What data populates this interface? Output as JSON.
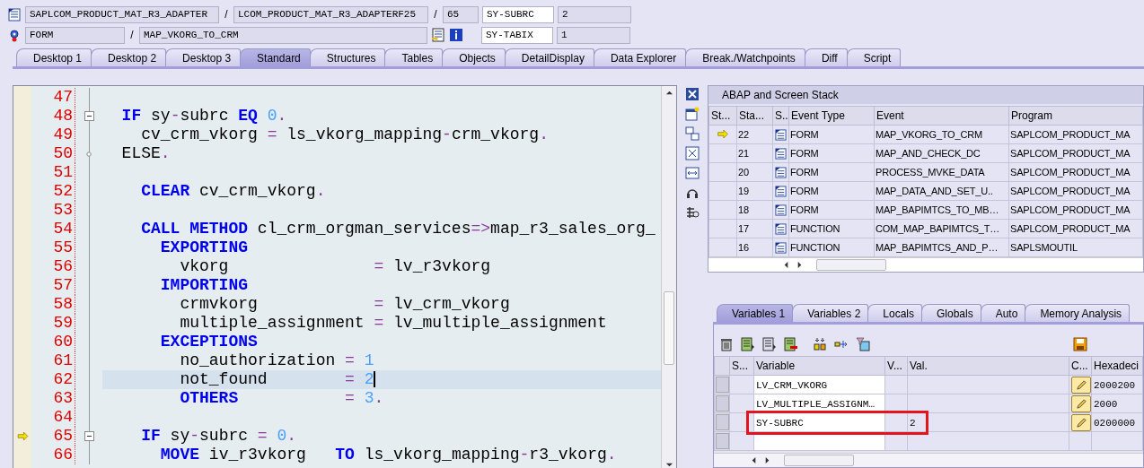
{
  "header": {
    "program": "SAPLCOM_PRODUCT_MAT_R3_ADAPTER",
    "sep_1": "/",
    "include": "LCOM_PRODUCT_MAT_R3_ADAPTERF25",
    "sep_2": "/",
    "line": "65",
    "event_type": "FORM",
    "sep_3": "/",
    "event": "MAP_VKORG_TO_CRM"
  },
  "system_fields": [
    {
      "name": "SY-SUBRC",
      "value": "2"
    },
    {
      "name": "SY-TABIX",
      "value": "1"
    }
  ],
  "tabs": [
    {
      "label": "Desktop 1",
      "selected": false
    },
    {
      "label": "Desktop 2",
      "selected": false
    },
    {
      "label": "Desktop 3",
      "selected": false
    },
    {
      "label": "Standard",
      "selected": true
    },
    {
      "label": "Structures",
      "selected": false
    },
    {
      "label": "Tables",
      "selected": false
    },
    {
      "label": "Objects",
      "selected": false
    },
    {
      "label": "DetailDisplay",
      "selected": false
    },
    {
      "label": "Data Explorer",
      "selected": false
    },
    {
      "label": "Break./Watchpoints",
      "selected": false
    },
    {
      "label": "Diff",
      "selected": false
    },
    {
      "label": "Script",
      "selected": false
    }
  ],
  "code": [
    {
      "number": "47",
      "collapsible": false,
      "branch": false,
      "current": false,
      "cursor": false
    },
    {
      "number": "48",
      "collapsible": true,
      "branch": false,
      "current": false,
      "cursor": false,
      "tokens": [
        {
          "kind": "kw",
          "text": "  IF"
        },
        {
          "kind": "id",
          "text": " sy"
        },
        {
          "kind": "op",
          "text": "-"
        },
        {
          "kind": "id",
          "text": "subrc "
        },
        {
          "kind": "kw",
          "text": "EQ "
        },
        {
          "kind": "num",
          "text": "0"
        },
        {
          "kind": "op",
          "text": "."
        }
      ]
    },
    {
      "number": "49",
      "collapsible": false,
      "branch": false,
      "current": false,
      "cursor": false,
      "tokens": [
        {
          "kind": "id",
          "text": "    cv_crm_vkorg "
        },
        {
          "kind": "op",
          "text": "="
        },
        {
          "kind": "id",
          "text": " ls_vkorg_mapping"
        },
        {
          "kind": "op",
          "text": "-"
        },
        {
          "kind": "id",
          "text": "crm_vkorg"
        },
        {
          "kind": "op",
          "text": "."
        }
      ]
    },
    {
      "number": "50",
      "collapsible": false,
      "branch": true,
      "current": false,
      "cursor": false,
      "tokens": [
        {
          "kind": "id",
          "text": "  ELSE"
        },
        {
          "kind": "op",
          "text": "."
        }
      ]
    },
    {
      "number": "51",
      "collapsible": false,
      "branch": false,
      "current": false,
      "cursor": false
    },
    {
      "number": "52",
      "collapsible": false,
      "branch": false,
      "current": false,
      "cursor": false,
      "tokens": [
        {
          "kind": "kw",
          "text": "    CLEAR"
        },
        {
          "kind": "id",
          "text": " cv_crm_vkorg"
        },
        {
          "kind": "op",
          "text": "."
        }
      ]
    },
    {
      "number": "53",
      "collapsible": false,
      "branch": false,
      "current": false,
      "cursor": false
    },
    {
      "number": "54",
      "collapsible": false,
      "branch": false,
      "current": false,
      "cursor": false,
      "tokens": [
        {
          "kind": "kw",
          "text": "    CALL METHOD"
        },
        {
          "kind": "id",
          "text": " cl_crm_orgman_services"
        },
        {
          "kind": "op",
          "text": "=>"
        },
        {
          "kind": "id",
          "text": "map_r3_sales_org_"
        }
      ]
    },
    {
      "number": "55",
      "collapsible": false,
      "branch": false,
      "current": false,
      "cursor": false,
      "tokens": [
        {
          "kind": "kw",
          "text": "      EXPORTING"
        }
      ]
    },
    {
      "number": "56",
      "collapsible": false,
      "branch": false,
      "current": false,
      "cursor": false,
      "tokens": [
        {
          "kind": "id",
          "text": "        vkorg               "
        },
        {
          "kind": "op",
          "text": "="
        },
        {
          "kind": "id",
          "text": " lv_r3vkorg"
        }
      ]
    },
    {
      "number": "57",
      "collapsible": false,
      "branch": false,
      "current": false,
      "cursor": false,
      "tokens": [
        {
          "kind": "kw",
          "text": "      IMPORTING"
        }
      ]
    },
    {
      "number": "58",
      "collapsible": false,
      "branch": false,
      "current": false,
      "cursor": false,
      "tokens": [
        {
          "kind": "id",
          "text": "        crmvkorg            "
        },
        {
          "kind": "op",
          "text": "="
        },
        {
          "kind": "id",
          "text": " lv_crm_vkorg"
        }
      ]
    },
    {
      "number": "59",
      "collapsible": false,
      "branch": false,
      "current": false,
      "cursor": false,
      "tokens": [
        {
          "kind": "id",
          "text": "        multiple_assignment "
        },
        {
          "kind": "op",
          "text": "="
        },
        {
          "kind": "id",
          "text": " lv_multiple_assignment"
        }
      ]
    },
    {
      "number": "60",
      "collapsible": false,
      "branch": false,
      "current": false,
      "cursor": false,
      "tokens": [
        {
          "kind": "kw",
          "text": "      EXCEPTIONS"
        }
      ]
    },
    {
      "number": "61",
      "collapsible": false,
      "branch": false,
      "current": false,
      "cursor": false,
      "tokens": [
        {
          "kind": "id",
          "text": "        no_authorization "
        },
        {
          "kind": "op",
          "text": "= "
        },
        {
          "kind": "num",
          "text": "1"
        }
      ]
    },
    {
      "number": "62",
      "collapsible": false,
      "branch": false,
      "current": false,
      "cursor": true,
      "tokens": [
        {
          "kind": "id",
          "text": "        not_found        "
        },
        {
          "kind": "op",
          "text": "= "
        },
        {
          "kind": "num",
          "text": "2"
        }
      ]
    },
    {
      "number": "63",
      "collapsible": false,
      "branch": false,
      "current": false,
      "cursor": false,
      "tokens": [
        {
          "kind": "kw",
          "text": "        OTHERS           "
        },
        {
          "kind": "op",
          "text": "= "
        },
        {
          "kind": "num",
          "text": "3"
        },
        {
          "kind": "op",
          "text": "."
        }
      ]
    },
    {
      "number": "64",
      "collapsible": false,
      "branch": false,
      "current": false,
      "cursor": false
    },
    {
      "number": "65",
      "collapsible": true,
      "branch": false,
      "current": true,
      "cursor": false,
      "tokens": [
        {
          "kind": "kw",
          "text": "    IF"
        },
        {
          "kind": "id",
          "text": " sy"
        },
        {
          "kind": "op",
          "text": "-"
        },
        {
          "kind": "id",
          "text": "subrc "
        },
        {
          "kind": "op",
          "text": "= "
        },
        {
          "kind": "num",
          "text": "0"
        },
        {
          "kind": "op",
          "text": "."
        }
      ]
    },
    {
      "number": "66",
      "collapsible": false,
      "branch": false,
      "current": false,
      "cursor": false,
      "tokens": [
        {
          "kind": "kw",
          "text": "      MOVE"
        },
        {
          "kind": "id",
          "text": " iv_r3vkorg   "
        },
        {
          "kind": "kw",
          "text": "TO"
        },
        {
          "kind": "id",
          "text": " ls_vkorg_mapping"
        },
        {
          "kind": "op",
          "text": "-"
        },
        {
          "kind": "id",
          "text": "r3_vkorg"
        },
        {
          "kind": "op",
          "text": "."
        }
      ]
    }
  ],
  "stack": {
    "title": "ABAP and Screen Stack",
    "columns": [
      "St...",
      "Sta...",
      "S..",
      "Event Type",
      "Event",
      "Program"
    ],
    "rows": [
      {
        "current": true,
        "number": "22",
        "event_type": "FORM",
        "event": "MAP_VKORG_TO_CRM",
        "program": "SAPLCOM_PRODUCT_MA"
      },
      {
        "current": false,
        "number": "21",
        "event_type": "FORM",
        "event": "MAP_AND_CHECK_DC",
        "program": "SAPLCOM_PRODUCT_MA"
      },
      {
        "current": false,
        "number": "20",
        "event_type": "FORM",
        "event": "PROCESS_MVKE_DATA",
        "program": "SAPLCOM_PRODUCT_MA"
      },
      {
        "current": false,
        "number": "19",
        "event_type": "FORM",
        "event": "MAP_DATA_AND_SET_U..",
        "program": "SAPLCOM_PRODUCT_MA"
      },
      {
        "current": false,
        "number": "18",
        "event_type": "FORM",
        "event": "MAP_BAPIMTCS_TO_MB…",
        "program": "SAPLCOM_PRODUCT_MA"
      },
      {
        "current": false,
        "number": "17",
        "event_type": "FUNCTION",
        "event": "COM_MAP_BAPIMTCS_T…",
        "program": "SAPLCOM_PRODUCT_MA"
      },
      {
        "current": false,
        "number": "16",
        "event_type": "FUNCTION",
        "event": "MAP_BAPIMTCS_AND_P…",
        "program": "SAPLSMOUTIL"
      }
    ]
  },
  "variable_tabs": [
    {
      "label": "Variables 1",
      "selected": true
    },
    {
      "label": "Variables 2",
      "selected": false
    },
    {
      "label": "Locals",
      "selected": false
    },
    {
      "label": "Globals",
      "selected": false
    },
    {
      "label": "Auto",
      "selected": false
    },
    {
      "label": "Memory Analysis",
      "selected": false
    }
  ],
  "variables": {
    "columns": [
      "S...",
      "Variable",
      "V...",
      "Val.",
      "C...",
      "Hexadeci"
    ],
    "rows": [
      {
        "variable": "LV_CRM_VKORG",
        "hex": "2000200",
        "marked": false
      },
      {
        "variable": "LV_MULTIPLE_ASSIGNM…",
        "hex": "2000",
        "marked": false
      },
      {
        "variable": "SY-SUBRC",
        "value": "2",
        "hex": "0200000",
        "marked": true
      }
    ]
  }
}
